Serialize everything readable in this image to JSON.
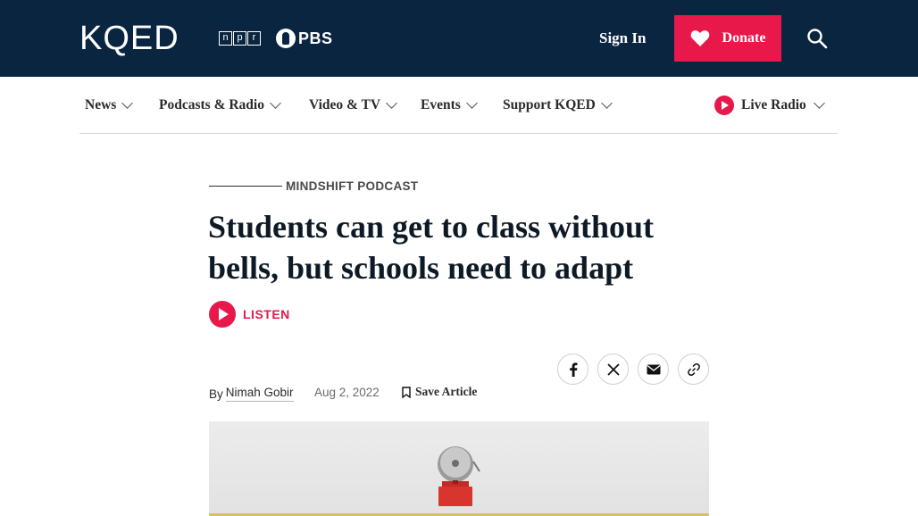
{
  "header": {
    "logo": "KQED",
    "npr_letters": [
      "n",
      "p",
      "r"
    ],
    "pbs_label": "PBS",
    "signin_label": "Sign In",
    "donate_label": "Donate",
    "colors": {
      "bar": "#0a2540",
      "accent": "#e8184a"
    },
    "icons": [
      "heart-icon",
      "search-icon"
    ]
  },
  "nav": {
    "items": [
      {
        "label": "News"
      },
      {
        "label": "Podcasts & Radio"
      },
      {
        "label": "Video & TV"
      },
      {
        "label": "Events"
      },
      {
        "label": "Support KQED"
      }
    ],
    "live_label": "Live Radio"
  },
  "article": {
    "kicker": "MINDSHIFT PODCAST",
    "headline": "Students can get to class without bells, but schools need to adapt",
    "listen_label": "LISTEN",
    "share_icons": [
      "facebook-icon",
      "x-icon",
      "email-icon",
      "link-icon"
    ],
    "by_label": "By",
    "author": "Nimah Gobir",
    "date": "Aug 2, 2022",
    "save_label": "Save Article",
    "image": "school-bell-image"
  }
}
